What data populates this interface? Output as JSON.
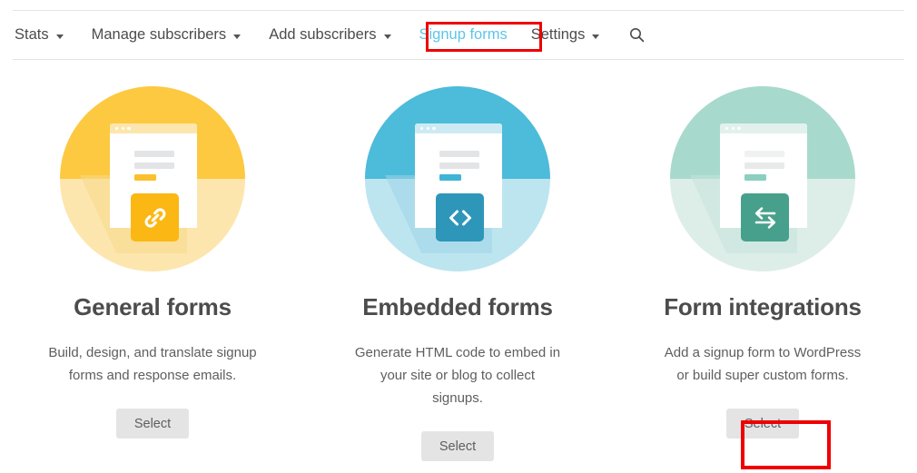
{
  "nav": {
    "items": [
      {
        "label": "Stats",
        "has_caret": true,
        "active": false
      },
      {
        "label": "Manage subscribers",
        "has_caret": true,
        "active": false
      },
      {
        "label": "Add subscribers",
        "has_caret": true,
        "active": false
      },
      {
        "label": "Signup forms",
        "has_caret": false,
        "active": true
      },
      {
        "label": "Settings",
        "has_caret": true,
        "active": false
      }
    ],
    "search_icon": "search-icon",
    "active_color": "#5bc6e8",
    "text_color": "#4c4c4c",
    "highlight_color": "#ee0000"
  },
  "cards": [
    {
      "title": "General forms",
      "description": "Build, design, and translate signup forms and response emails.",
      "button_label": "Select",
      "icon": "link-icon",
      "highlighted": false,
      "colors": {
        "circle_top": "#fcc940",
        "circle_bottom": "#fde6ae",
        "badge": "#fbb713",
        "doc_bar": "#fde6ae",
        "doc_dot": "#ffffff",
        "accent_line": "#fbc02d",
        "shadow": "#f7d98c"
      }
    },
    {
      "title": "Embedded forms",
      "description": "Generate HTML code to embed in your site or blog to collect signups.",
      "button_label": "Select",
      "icon": "code-icon",
      "highlighted": false,
      "colors": {
        "circle_top": "#4dbbda",
        "circle_bottom": "#bde5f0",
        "badge": "#2e96b9",
        "doc_bar": "#cdeaf4",
        "doc_dot": "#ffffff",
        "accent_line": "#3fb4d6",
        "shadow": "#9fd6e7"
      }
    },
    {
      "title": "Form integrations",
      "description": "Add a signup form to WordPress or build super custom forms.",
      "button_label": "Select",
      "icon": "swap-arrows-icon",
      "highlighted": true,
      "colors": {
        "circle_top": "#a8d9cd",
        "circle_bottom": "#ddeee9",
        "badge": "#47a08b",
        "doc_bar": "#e3f1ed",
        "doc_dot": "#ffffff",
        "accent_line": "#8acfc0",
        "shadow": "#c6e3dc"
      }
    }
  ]
}
